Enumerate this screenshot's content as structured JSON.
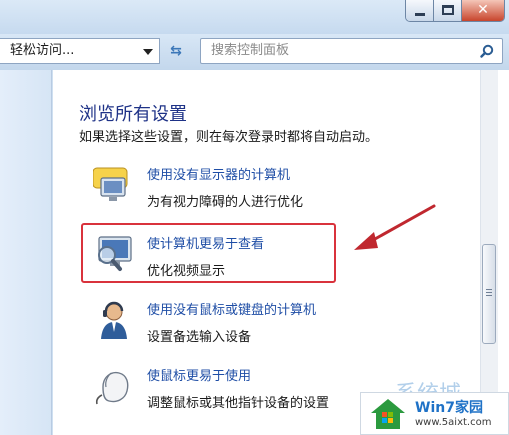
{
  "address": {
    "breadcrumb": "轻松访问...",
    "search_placeholder": "搜索控制面板"
  },
  "main": {
    "heading": "浏览所有设置",
    "description": "如果选择这些设置，则在每次登录时都将自动启动。",
    "items": [
      {
        "link": "使用没有显示器的计算机",
        "sub": "为有视力障碍的人进行优化",
        "icon": "speech-monitor-icon"
      },
      {
        "link": "使计算机更易于查看",
        "sub": "优化视频显示",
        "icon": "magnifier-monitor-icon"
      },
      {
        "link": "使用没有鼠标或键盘的计算机",
        "sub": "设置备选输入设备",
        "icon": "headset-user-icon"
      },
      {
        "link": "使鼠标更易于使用",
        "sub": "调整鼠标或其他指针设备的设置",
        "icon": "mouse-icon"
      }
    ]
  },
  "watermark": {
    "title": "Win7家园",
    "url": "www.5aixt.com",
    "bg_text": "系统城"
  },
  "colors": {
    "link": "#1f4ea6",
    "heading": "#1e3287",
    "highlight": "#d9323c"
  }
}
